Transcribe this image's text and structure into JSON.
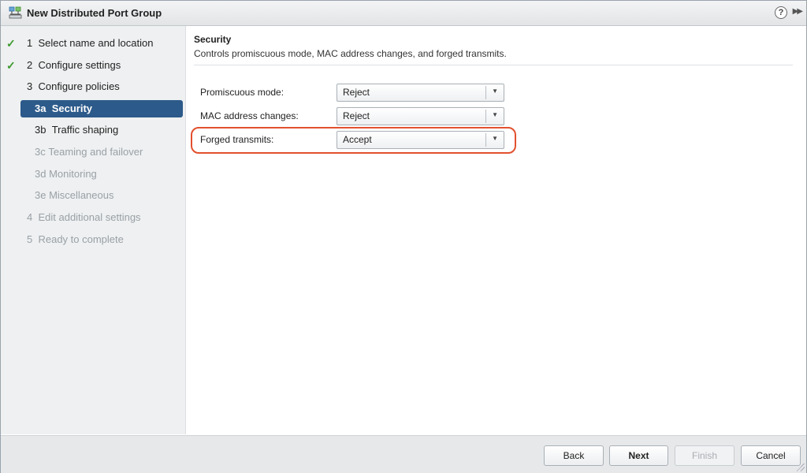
{
  "window": {
    "title": "New Distributed Port Group"
  },
  "titlebar": {
    "help_glyph": "?",
    "expand_glyph": "▶▶"
  },
  "steps": [
    {
      "number": "1",
      "label": "Select name and location",
      "state": "done"
    },
    {
      "number": "2",
      "label": "Configure settings",
      "state": "done"
    },
    {
      "number": "3",
      "label": "Configure policies",
      "state": "active-parent"
    },
    {
      "number": "3a",
      "label": "Security",
      "state": "selected"
    },
    {
      "number": "3b",
      "label": "Traffic shaping",
      "state": "active-parent"
    },
    {
      "number": "3c",
      "label": "Teaming and failover",
      "state": "disabled"
    },
    {
      "number": "3d",
      "label": "Monitoring",
      "state": "disabled"
    },
    {
      "number": "3e",
      "label": "Miscellaneous",
      "state": "disabled"
    },
    {
      "number": "4",
      "label": "Edit additional settings",
      "state": "disabled"
    },
    {
      "number": "5",
      "label": "Ready to complete",
      "state": "disabled"
    }
  ],
  "section": {
    "title": "Security",
    "description": "Controls promiscuous mode, MAC address changes, and forged transmits."
  },
  "settings": [
    {
      "label": "Promiscuous mode:",
      "value": "Reject"
    },
    {
      "label": "MAC address changes:",
      "value": "Reject"
    },
    {
      "label": "Forged transmits:",
      "value": "Accept"
    }
  ],
  "footer": {
    "back": "Back",
    "next": "Next",
    "finish": "Finish",
    "cancel": "Cancel"
  },
  "colors": {
    "selected_step": "#2c5a8a",
    "check": "#3d9a2d",
    "highlight": "#e2512f"
  },
  "icons": {
    "title": "distributed-port-group-icon",
    "done": "checkmark-icon",
    "dropdown": "chevron-down-icon"
  }
}
